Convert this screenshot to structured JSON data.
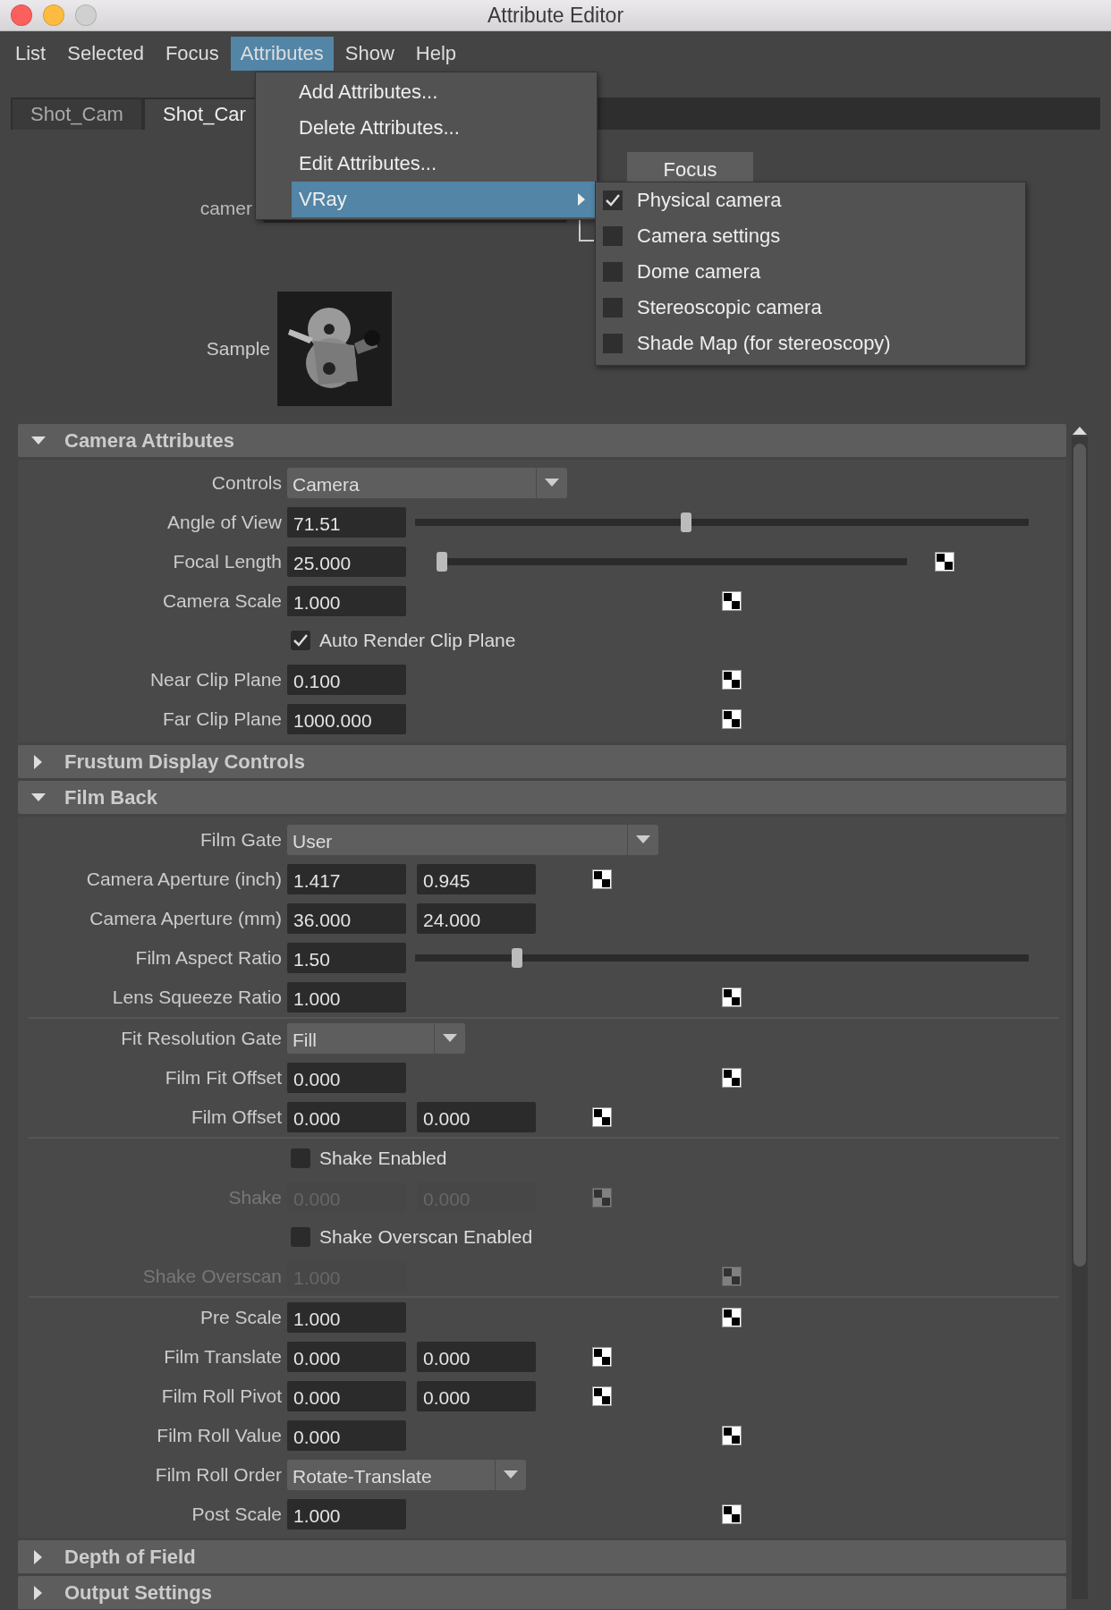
{
  "window": {
    "title": "Attribute Editor"
  },
  "menu_bar": [
    {
      "label": "List",
      "selected": false
    },
    {
      "label": "Selected",
      "selected": false
    },
    {
      "label": "Focus",
      "selected": false
    },
    {
      "label": "Attributes",
      "selected": true
    },
    {
      "label": "Show",
      "selected": false
    },
    {
      "label": "Help",
      "selected": false
    }
  ],
  "tabs": [
    {
      "label": "Shot_Cam",
      "selected": false
    },
    {
      "label": "Shot_Car",
      "selected": true
    }
  ],
  "node": {
    "label": "camer",
    "focus_button": "Focus",
    "sample_label": "Sample"
  },
  "sections": [
    {
      "title": "Camera Attributes",
      "expanded": true,
      "rows": [
        {
          "kind": "dropdown",
          "label": "Controls",
          "value": "Camera"
        },
        {
          "kind": "slider",
          "label": "Angle of View",
          "values": [
            "71.51"
          ],
          "level": 0.44,
          "map": false,
          "disabled": false
        },
        {
          "kind": "slider",
          "label": "Focal Length",
          "values": [
            "25.000"
          ],
          "level": 0,
          "map": true,
          "disabled": false
        },
        {
          "kind": "field",
          "label": "Camera Scale",
          "values": [
            "1.000"
          ],
          "map": true,
          "disabled": false
        },
        {
          "kind": "checkbox",
          "label": "Auto Render Clip Plane",
          "checked": true
        },
        {
          "kind": "field",
          "label": "Near Clip Plane",
          "values": [
            "0.100"
          ],
          "map": true,
          "disabled": false
        },
        {
          "kind": "field",
          "label": "Far Clip Plane",
          "values": [
            "1000.000"
          ],
          "map": true,
          "disabled": false
        }
      ]
    },
    {
      "title": "Frustum Display Controls",
      "expanded": false
    },
    {
      "title": "Film Back",
      "expanded": true,
      "rows": [
        {
          "kind": "dropdown",
          "label": "Film Gate",
          "value": "User"
        },
        {
          "kind": "field",
          "label": "Camera Aperture (inch)",
          "values": [
            "1.417",
            "0.945"
          ],
          "map": true,
          "disabled": false
        },
        {
          "kind": "field",
          "label": "Camera Aperture (mm)",
          "values": [
            "36.000",
            "24.000"
          ],
          "map": false,
          "disabled": false
        },
        {
          "kind": "slider",
          "label": "Film Aspect Ratio",
          "values": [
            "1.50"
          ],
          "level": 0.16,
          "map": false,
          "disabled": false
        },
        {
          "kind": "field",
          "label": "Lens Squeeze Ratio",
          "values": [
            "1.000"
          ],
          "map": true,
          "disabled": false
        },
        {
          "kind": "divider"
        },
        {
          "kind": "dropdown",
          "label": "Fit Resolution Gate",
          "value": "Fill"
        },
        {
          "kind": "field",
          "label": "Film Fit Offset",
          "values": [
            "0.000"
          ],
          "map": true,
          "disabled": false
        },
        {
          "kind": "field",
          "label": "Film Offset",
          "values": [
            "0.000",
            "0.000"
          ],
          "map": true,
          "disabled": false
        },
        {
          "kind": "divider"
        },
        {
          "kind": "checkbox",
          "label": "Shake Enabled",
          "checked": false
        },
        {
          "kind": "field",
          "label": "Shake",
          "values": [
            "0.000",
            "0.000"
          ],
          "map": true,
          "disabled": true
        },
        {
          "kind": "checkbox",
          "label": "Shake Overscan Enabled",
          "checked": false
        },
        {
          "kind": "field",
          "label": "Shake Overscan",
          "values": [
            "1.000"
          ],
          "map": true,
          "disabled": true
        },
        {
          "kind": "divider"
        },
        {
          "kind": "field",
          "label": "Pre Scale",
          "values": [
            "1.000"
          ],
          "map": true,
          "disabled": false
        },
        {
          "kind": "field",
          "label": "Film Translate",
          "values": [
            "0.000",
            "0.000"
          ],
          "map": true,
          "disabled": false
        },
        {
          "kind": "field",
          "label": "Film Roll Pivot",
          "values": [
            "0.000",
            "0.000"
          ],
          "map": true,
          "disabled": false
        },
        {
          "kind": "field",
          "label": "Film Roll Value",
          "values": [
            "0.000"
          ],
          "map": true,
          "disabled": false
        },
        {
          "kind": "dropdown",
          "label": "Film Roll Order",
          "value": "Rotate-Translate"
        },
        {
          "kind": "field",
          "label": "Post Scale",
          "values": [
            "1.000"
          ],
          "map": true,
          "disabled": false
        }
      ]
    },
    {
      "title": "Depth of Field",
      "expanded": false
    },
    {
      "title": "Output Settings",
      "expanded": false
    }
  ],
  "attributes_menu": [
    {
      "label": "Add Attributes...",
      "selected": false,
      "submenu": false
    },
    {
      "label": "Delete Attributes...",
      "selected": false,
      "submenu": false
    },
    {
      "label": "Edit Attributes...",
      "selected": false,
      "submenu": false
    },
    {
      "label": "VRay",
      "selected": true,
      "submenu": true
    }
  ],
  "vray_submenu": [
    {
      "label": "Physical camera",
      "checked": true
    },
    {
      "label": "Camera settings",
      "checked": false
    },
    {
      "label": "Dome camera",
      "checked": false
    },
    {
      "label": "Stereoscopic camera",
      "checked": false
    },
    {
      "label": "Shade Map (for stereoscopy)",
      "checked": false
    }
  ]
}
